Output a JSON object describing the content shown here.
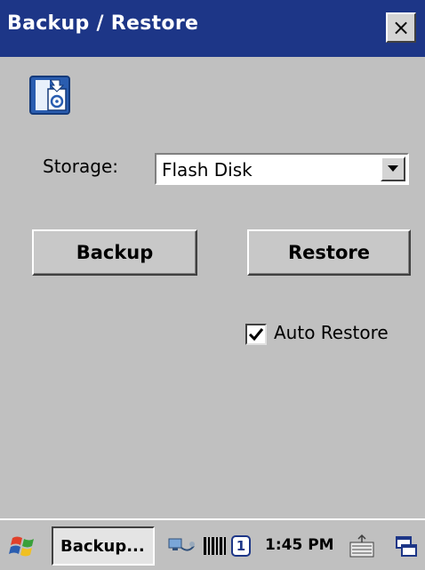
{
  "window": {
    "title": "Backup / Restore",
    "close_label": "×"
  },
  "app_icon": "backup-restore-icon",
  "storage": {
    "label": "Storage:",
    "selected": "Flash Disk"
  },
  "buttons": {
    "backup": "Backup",
    "restore": "Restore"
  },
  "auto_restore": {
    "label": "Auto Restore",
    "checked": true
  },
  "taskbar": {
    "start_icon": "windows-start-icon",
    "task_label": "Backup...",
    "tray_number": "1",
    "time": "1:45 PM"
  },
  "colors": {
    "titlebar": "#1d3687",
    "background": "#c0c0c0"
  }
}
